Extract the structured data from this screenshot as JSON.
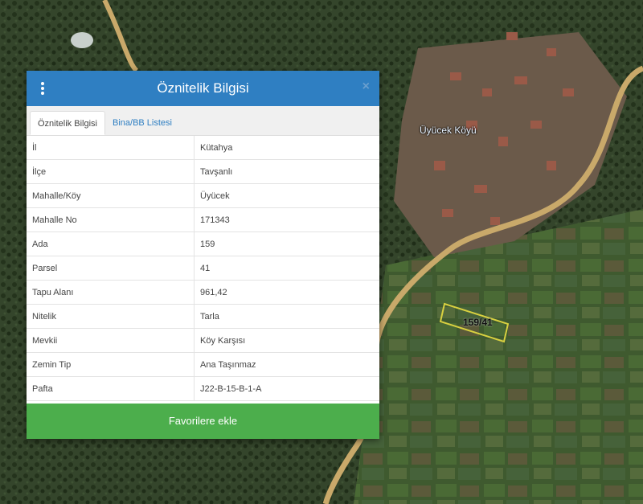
{
  "map": {
    "village_label": "Üyücek Köyü",
    "parcel_label": "159/41"
  },
  "panel": {
    "title": "Öznitelik Bilgisi",
    "close_glyph": "×",
    "tabs": [
      {
        "label": "Öznitelik Bilgisi",
        "active": true
      },
      {
        "label": "Bina/BB Listesi",
        "active": false
      }
    ],
    "rows": [
      {
        "key": "İl",
        "value": "Kütahya"
      },
      {
        "key": "İlçe",
        "value": "Tavşanlı"
      },
      {
        "key": "Mahalle/Köy",
        "value": "Üyücek"
      },
      {
        "key": "Mahalle No",
        "value": "171343"
      },
      {
        "key": "Ada",
        "value": "159"
      },
      {
        "key": "Parsel",
        "value": "41"
      },
      {
        "key": "Tapu Alanı",
        "value": "961,42"
      },
      {
        "key": "Nitelik",
        "value": "Tarla"
      },
      {
        "key": "Mevkii",
        "value": "Köy Karşısı"
      },
      {
        "key": "Zemin Tip",
        "value": "Ana Taşınmaz"
      },
      {
        "key": "Pafta",
        "value": "J22-B-15-B-1-A"
      }
    ],
    "favorite_button": "Favorilere ekle"
  },
  "colors": {
    "header": "#2f7fc2",
    "button": "#4cae4c",
    "road": "#c9a96a",
    "parcel_outline": "#d8d040"
  }
}
